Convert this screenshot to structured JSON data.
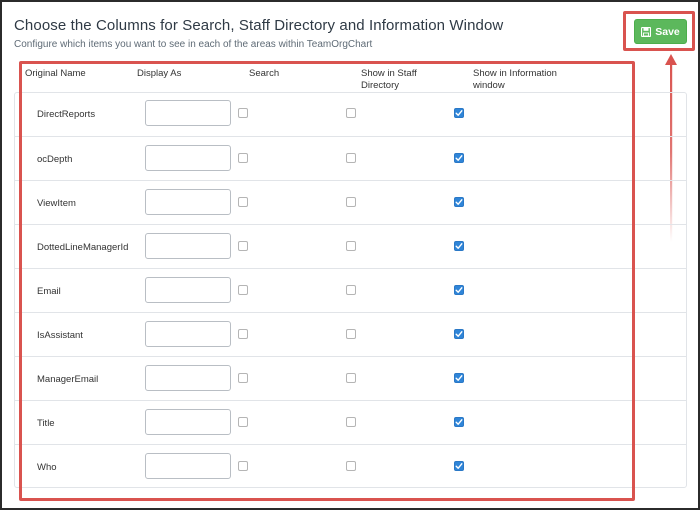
{
  "page": {
    "title": "Choose the Columns for Search, Staff Directory and Information Window",
    "subtitle": "Configure which items you want to see in each of the areas within TeamOrgChart"
  },
  "toolbar": {
    "save_label": "Save",
    "save_icon": "floppy-disk-icon"
  },
  "colors": {
    "save_green": "#5cb85c",
    "highlight_red": "#d9534f",
    "check_blue": "#2f85d8"
  },
  "table": {
    "headers": {
      "original_name": "Original Name",
      "display_as": "Display As",
      "search": "Search",
      "staff_directory_line1": "Show in Staff",
      "staff_directory_line2": "Directory",
      "info_window_line1": "Show in Information",
      "info_window_line2": "window"
    },
    "rows": [
      {
        "name": "DirectReports",
        "display_as": "",
        "search": false,
        "staff_directory": false,
        "info_window": true
      },
      {
        "name": "ocDepth",
        "display_as": "",
        "search": false,
        "staff_directory": false,
        "info_window": true
      },
      {
        "name": "ViewItem",
        "display_as": "",
        "search": false,
        "staff_directory": false,
        "info_window": true
      },
      {
        "name": "DottedLineManagerId",
        "display_as": "",
        "search": false,
        "staff_directory": false,
        "info_window": true
      },
      {
        "name": "Email",
        "display_as": "",
        "search": false,
        "staff_directory": false,
        "info_window": true
      },
      {
        "name": "IsAssistant",
        "display_as": "",
        "search": false,
        "staff_directory": false,
        "info_window": true
      },
      {
        "name": "ManagerEmail",
        "display_as": "",
        "search": false,
        "staff_directory": false,
        "info_window": true
      },
      {
        "name": "Title",
        "display_as": "",
        "search": false,
        "staff_directory": false,
        "info_window": true
      },
      {
        "name": "Who",
        "display_as": "",
        "search": false,
        "staff_directory": false,
        "info_window": true
      }
    ]
  }
}
